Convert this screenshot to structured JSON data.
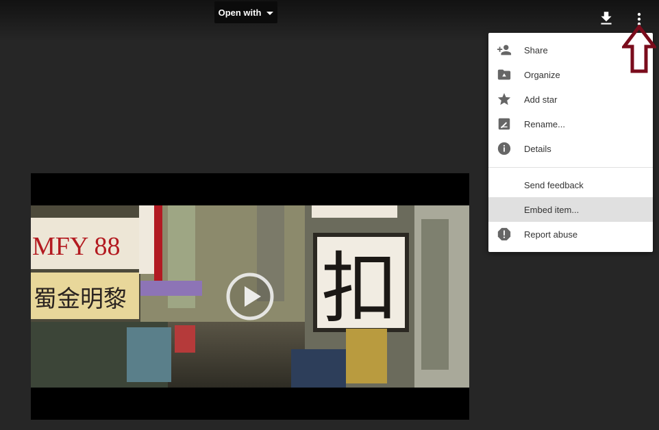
{
  "toolbar": {
    "open_with_label": "Open with",
    "download_icon": "download-icon",
    "more_icon": "more-vert-icon"
  },
  "menu": {
    "items": [
      {
        "label": "Share",
        "icon": "person-add-icon"
      },
      {
        "label": "Organize",
        "icon": "drive-folder-icon"
      },
      {
        "label": "Add star",
        "icon": "star-icon"
      },
      {
        "label": "Rename...",
        "icon": "rename-icon"
      },
      {
        "label": "Details",
        "icon": "info-icon"
      }
    ],
    "secondary_items": [
      {
        "label": "Send feedback"
      },
      {
        "label": "Embed item...",
        "highlighted": true
      },
      {
        "label": "Report abuse",
        "icon": "report-icon"
      }
    ]
  },
  "annotation": {
    "icon": "red-up-arrow-icon",
    "color": "#7a0c1c"
  },
  "video": {
    "sign_left_top": "MFY 88",
    "sign_left_bottom": "蜀金明黎",
    "sign_right": "扣",
    "play_icon": "play-icon"
  }
}
